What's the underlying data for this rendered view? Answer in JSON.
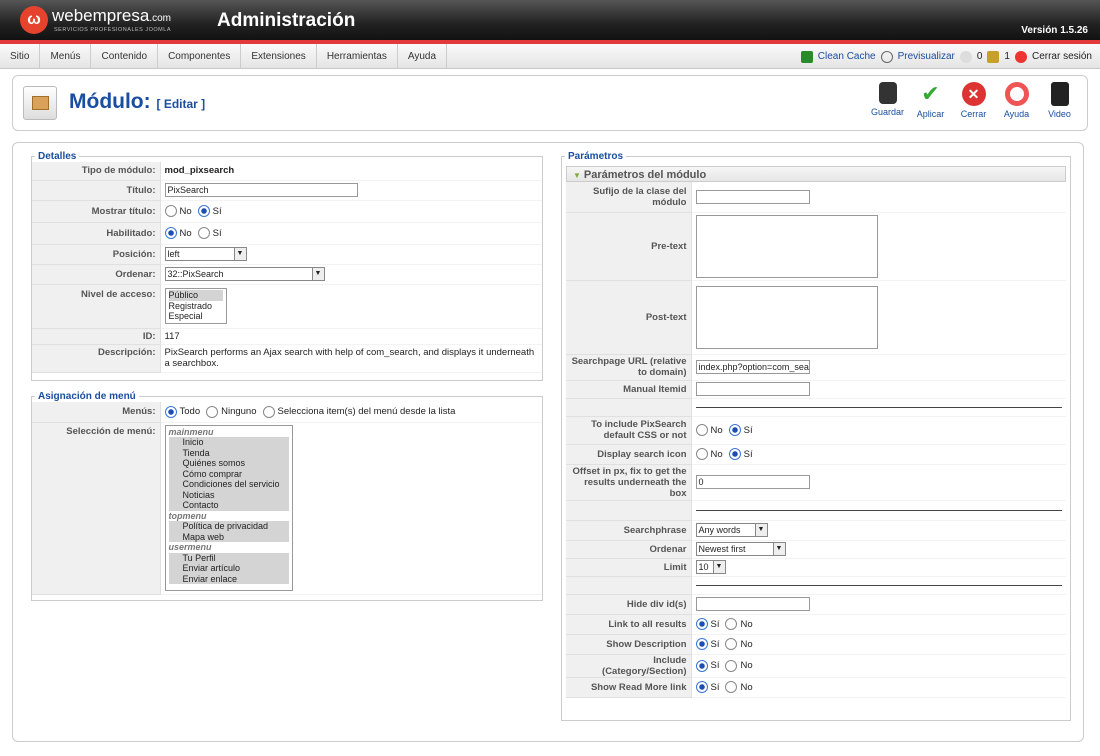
{
  "header": {
    "brand": "webempresa",
    "brand_suffix": ".com",
    "brand_sub": "SERVICIOS PROFESIONALES JOOMLA",
    "title": "Administración",
    "version": "Versión 1.5.26"
  },
  "menu": {
    "items": [
      "Sitio",
      "Menús",
      "Contenido",
      "Componentes",
      "Extensiones",
      "Herramientas",
      "Ayuda"
    ]
  },
  "status": {
    "clean_cache": "Clean Cache",
    "preview": "Previsualizar",
    "messages": "0",
    "users": "1",
    "logout": "Cerrar sesión"
  },
  "page": {
    "title": "Módulo:",
    "subtitle": "[ Editar ]"
  },
  "toolbar": {
    "save": "Guardar",
    "apply": "Aplicar",
    "close": "Cerrar",
    "help": "Ayuda",
    "video": "Video"
  },
  "details": {
    "legend": "Detalles",
    "type_label": "Tipo de módulo:",
    "type_value": "mod_pixsearch",
    "title_label": "Título:",
    "title_value": "PixSearch",
    "show_title_label": "Mostrar título:",
    "no": "No",
    "yes": "Sí",
    "enabled_label": "Habilitado:",
    "position_label": "Posición:",
    "position_value": "left",
    "order_label": "Ordenar:",
    "order_value": "32::PixSearch",
    "access_label": "Nivel de acceso:",
    "access_options": [
      "Público",
      "Registrado",
      "Especial"
    ],
    "id_label": "ID:",
    "id_value": "117",
    "desc_label": "Descripción:",
    "desc_value": "PixSearch performs an Ajax search with help of com_search, and displays it underneath a searchbox."
  },
  "menu_assign": {
    "legend": "Asignación de menú",
    "menus_label": "Menús:",
    "opt_all": "Todo",
    "opt_none": "Ninguno",
    "opt_select": "Selecciona item(s) del menú desde la lista",
    "selection_label": "Selección de menú:",
    "list": {
      "g1": "mainmenu",
      "g1_items": [
        "Inicio",
        "Tienda",
        "Quiénes somos",
        "Cómo comprar",
        "Condiciones del servicio",
        "Noticias",
        "Contacto"
      ],
      "g2": "topmenu",
      "g2_items": [
        "Política de privacidad",
        "Mapa web"
      ],
      "g3": "usermenu",
      "g3_items": [
        "Tu Perfil",
        "Enviar artículo",
        "Enviar enlace"
      ]
    }
  },
  "params": {
    "legend": "Parámetros",
    "panel": "Parámetros del módulo",
    "suffix_label": "Sufijo de la clase del módulo",
    "pretext_label": "Pre-text",
    "posttext_label": "Post-text",
    "searchpage_label": "Searchpage URL (relative to domain)",
    "searchpage_value": "index.php?option=com_sea",
    "itemid_label": "Manual Itemid",
    "css_label": "To include PixSearch default CSS or not",
    "icon_label": "Display search icon",
    "offset_label": "Offset in px, fix to get the results underneath the box",
    "offset_value": "0",
    "phrase_label": "Searchphrase",
    "phrase_value": "Any words",
    "order_label": "Ordenar",
    "order_value": "Newest first",
    "limit_label": "Limit",
    "limit_value": "10",
    "hide_label": "Hide div id(s)",
    "link_label": "Link to all results",
    "showdesc_label": "Show Description",
    "include_label": "Include (Category/Section)",
    "readmore_label": "Show Read More link",
    "no": "No",
    "yes": "Sí"
  },
  "colors": {
    "accent": "#1a4ea0",
    "topbar": "#222222",
    "red": "#e23a3a"
  }
}
